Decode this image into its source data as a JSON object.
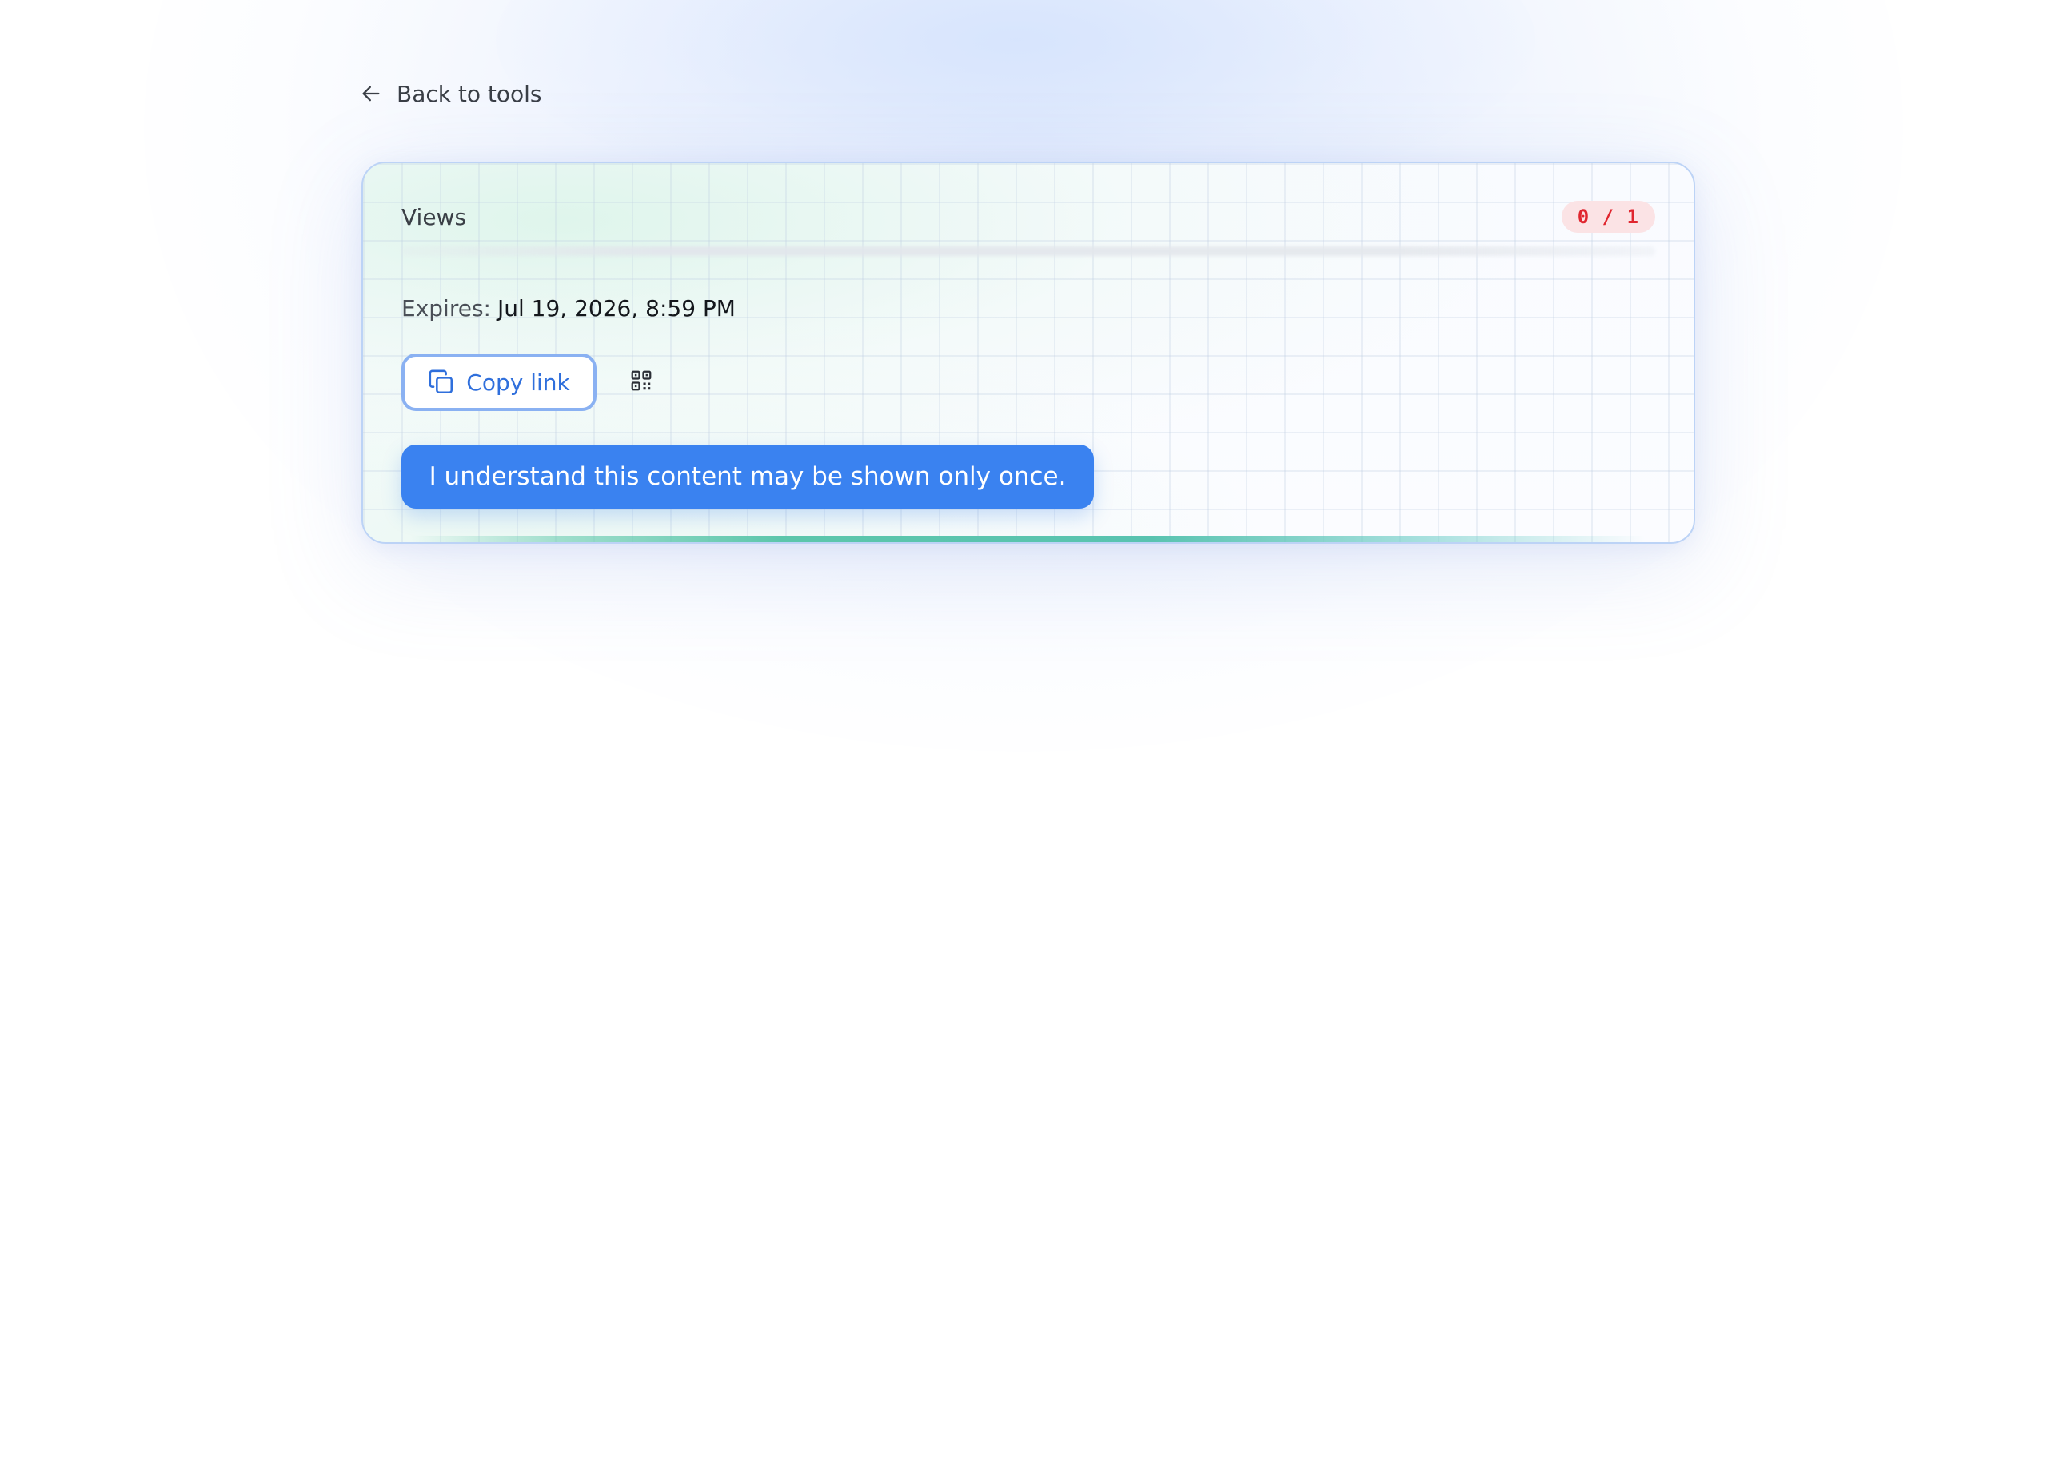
{
  "nav": {
    "back_label": "Back to tools"
  },
  "card": {
    "views": {
      "label": "Views",
      "count": "0 / 1"
    },
    "expires": {
      "label": "Expires:",
      "value": "Jul 19, 2026, 8:59 PM"
    },
    "actions": {
      "copy_label": "Copy link",
      "copy_icon": "copy-icon",
      "qr_icon": "qr-code-icon"
    },
    "confirm_label": "I understand this content may be shown only once."
  },
  "colors": {
    "accent": "#3a82f0",
    "badge_text": "#e0262f",
    "badge_bg": "#fbe3e5",
    "progress": "#5cc6ab"
  }
}
